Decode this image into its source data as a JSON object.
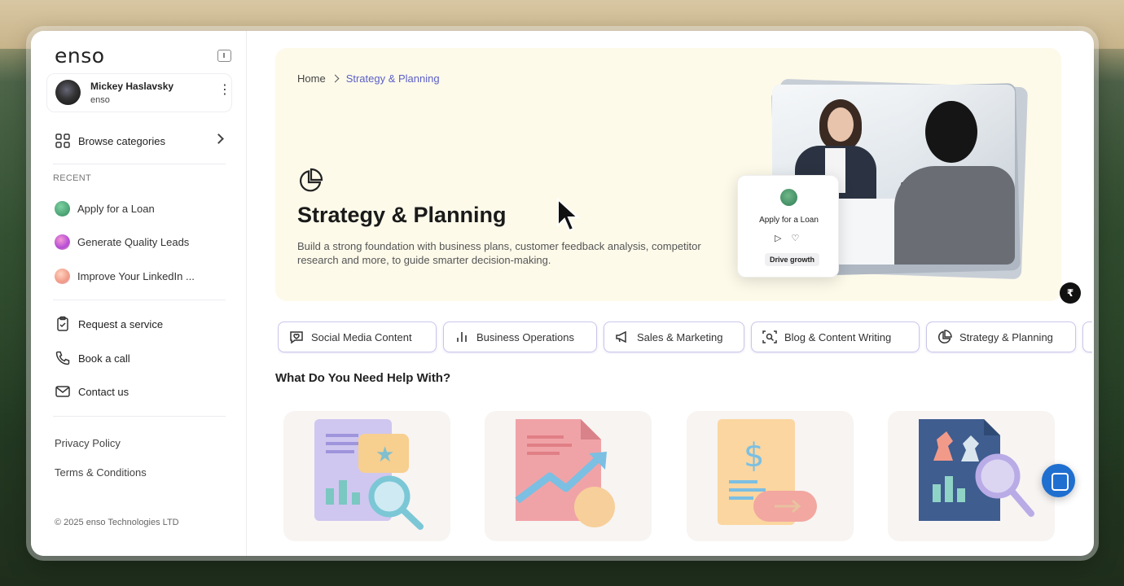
{
  "brand": {
    "logo_text": "enso"
  },
  "user": {
    "name": "Mickey Haslavsky",
    "org": "enso"
  },
  "sidebar": {
    "browse_label": "Browse categories",
    "recent_header": "RECENT",
    "recent_items": [
      {
        "label": "Apply for a Loan",
        "color": "#3e9b6b"
      },
      {
        "label": "Generate Quality Leads",
        "color": "#d86bc9"
      },
      {
        "label": "Improve Your LinkedIn ...",
        "color": "#f2a58e"
      }
    ],
    "links": [
      {
        "label": "Request a service",
        "icon": "clipboard-check-icon"
      },
      {
        "label": "Book a call",
        "icon": "phone-icon"
      },
      {
        "label": "Contact us",
        "icon": "mail-icon"
      }
    ],
    "footer_links": [
      "Privacy Policy",
      "Terms & Conditions"
    ],
    "copyright": "© 2025 enso Technologies LTD"
  },
  "breadcrumb": {
    "home": "Home",
    "current": "Strategy & Planning"
  },
  "hero": {
    "title": "Strategy & Planning",
    "description": "Build a strong foundation with business plans, customer feedback analysis, competitor research and more, to guide smarter decision-making.",
    "icon": "pie-chart-icon",
    "background": "#fdfaea",
    "float_card": {
      "title": "Apply for a Loan",
      "tag": "Drive growth"
    }
  },
  "tabs": [
    {
      "label": "Social Media Content",
      "icon": "chat-heart-icon"
    },
    {
      "label": "Business Operations",
      "icon": "bar-chart-icon"
    },
    {
      "label": "Sales & Marketing",
      "icon": "megaphone-icon"
    },
    {
      "label": "Blog & Content Writing",
      "icon": "search-frame-icon"
    },
    {
      "label": "Strategy & Planning",
      "icon": "pie-chart-icon"
    }
  ],
  "section_title": "What Do You Need Help With?",
  "colors": {
    "accent": "#5b5fc7",
    "tab_border": "#c9c6ea",
    "help_button": "#1f6fd0"
  }
}
